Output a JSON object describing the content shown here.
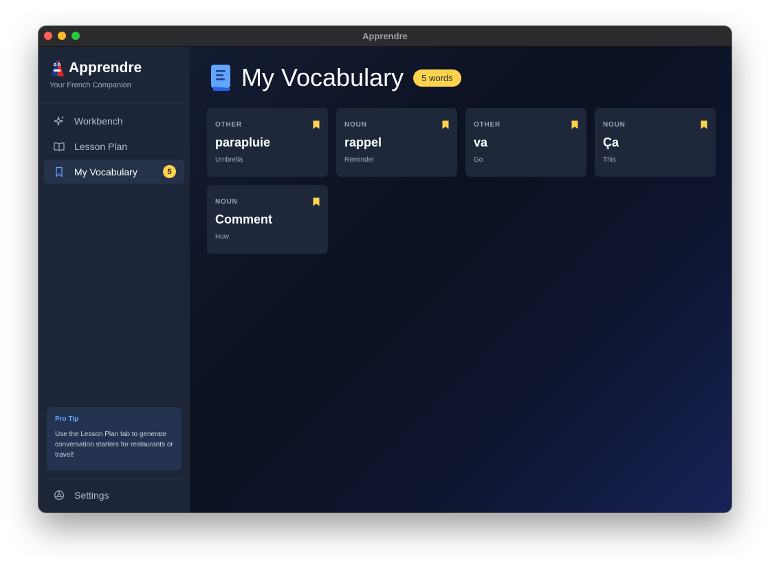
{
  "window": {
    "title": "Apprendre"
  },
  "brand": {
    "name": "Apprendre",
    "subtitle": "Your French Companion"
  },
  "nav": {
    "items": [
      {
        "label": "Workbench",
        "icon": "sparkle-icon"
      },
      {
        "label": "Lesson Plan",
        "icon": "book-open-icon"
      },
      {
        "label": "My Vocabulary",
        "icon": "bookmark-icon",
        "badge": "5",
        "active": true
      }
    ]
  },
  "protip": {
    "title": "Pro Tip",
    "body": "Use the Lesson Plan tab to generate conversation starters for restaurants or travel!"
  },
  "settings": {
    "label": "Settings",
    "icon": "gear-icon"
  },
  "page": {
    "title": "My Vocabulary",
    "count_badge": "5 words",
    "icon": "vocabulary-book-icon"
  },
  "cards": [
    {
      "type": "OTHER",
      "word": "parapluie",
      "translation": "Umbrella"
    },
    {
      "type": "NOUN",
      "word": "rappel",
      "translation": "Reminder"
    },
    {
      "type": "OTHER",
      "word": "va",
      "translation": "Go"
    },
    {
      "type": "NOUN",
      "word": "Ça",
      "translation": "This"
    },
    {
      "type": "NOUN",
      "word": "Comment",
      "translation": "How"
    }
  ],
  "colors": {
    "accent": "#fcd34d",
    "link": "#60a5fa",
    "sidebar_bg": "#1c2638",
    "card_bg": "#1e283a"
  }
}
